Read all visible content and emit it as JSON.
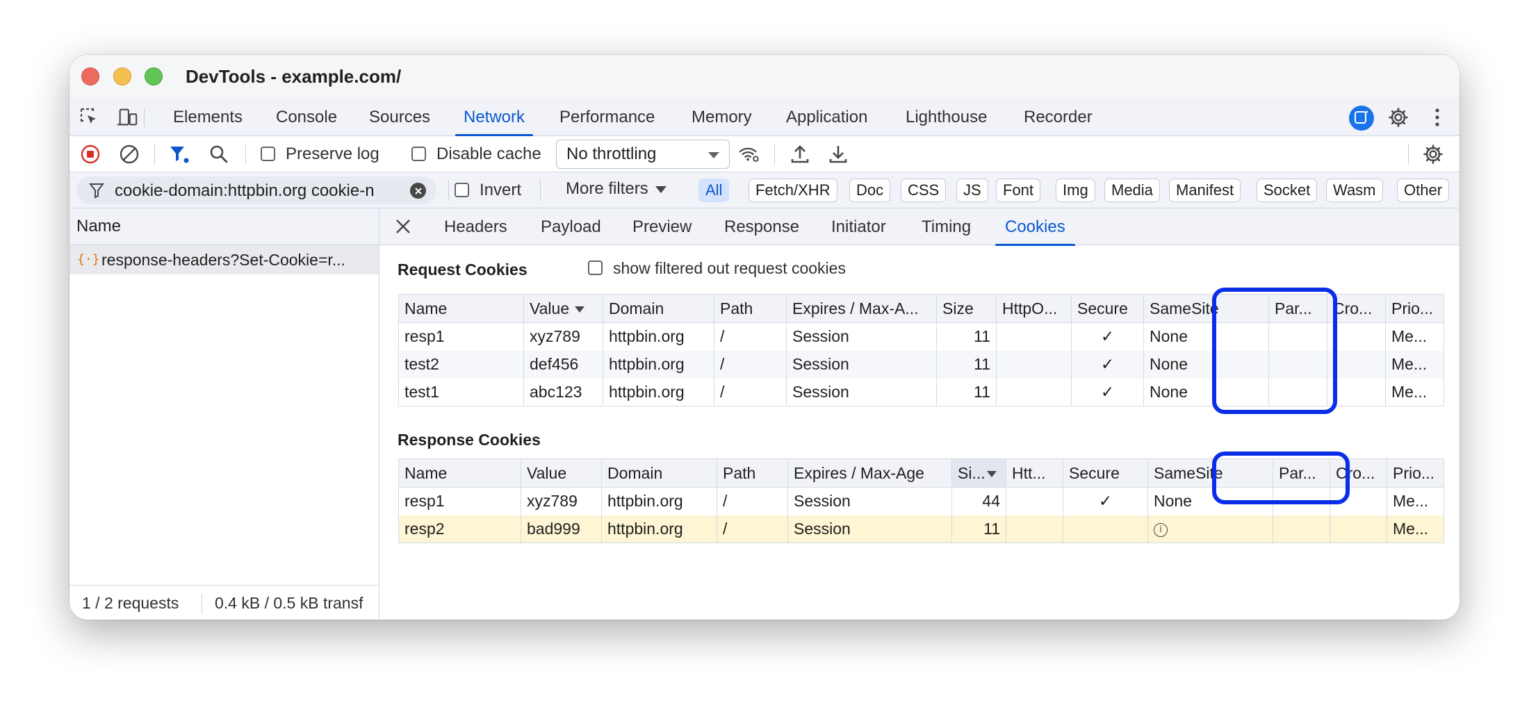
{
  "window": {
    "title": "DevTools - example.com/"
  },
  "main_tabs": [
    {
      "label": "Elements"
    },
    {
      "label": "Console"
    },
    {
      "label": "Sources"
    },
    {
      "label": "Network",
      "active": true
    },
    {
      "label": "Performance"
    },
    {
      "label": "Memory"
    },
    {
      "label": "Application"
    },
    {
      "label": "Lighthouse"
    },
    {
      "label": "Recorder"
    }
  ],
  "toolbar": {
    "preserve_log": "Preserve log",
    "disable_cache": "Disable cache",
    "throttling": "No throttling"
  },
  "filter": {
    "text": "cookie-domain:httpbin.org cookie-n",
    "invert": "Invert",
    "more_filters": "More filters",
    "types": [
      "All",
      "Fetch/XHR",
      "Doc",
      "CSS",
      "JS",
      "Font",
      "Img",
      "Media",
      "Manifest",
      "Socket",
      "Wasm",
      "Other"
    ],
    "active_type": "All"
  },
  "requests": {
    "column_name": "Name",
    "items": [
      {
        "name": "response-headers?Set-Cookie=r...",
        "icon": "fetch-icon"
      }
    ],
    "footer_requests": "1 / 2 requests",
    "footer_transfer": "0.4 kB / 0.5 kB transf"
  },
  "detail_tabs": [
    {
      "label": "Headers"
    },
    {
      "label": "Payload"
    },
    {
      "label": "Preview"
    },
    {
      "label": "Response"
    },
    {
      "label": "Initiator"
    },
    {
      "label": "Timing"
    },
    {
      "label": "Cookies",
      "active": true
    }
  ],
  "request_cookies": {
    "title": "Request Cookies",
    "show_filtered": "show filtered out request cookies",
    "columns": [
      "Name",
      "Value",
      "Domain",
      "Path",
      "Expires / Max-A...",
      "Size",
      "HttpO...",
      "Secure",
      "SameSite",
      "Par...",
      "Cro...",
      "Prio..."
    ],
    "rows": [
      {
        "name": "resp1",
        "value": "xyz789",
        "domain": "httpbin.org",
        "path": "/",
        "expires": "Session",
        "size": "11",
        "httponly": "",
        "secure": "✓",
        "samesite": "None",
        "partition": "",
        "cross": "",
        "priority": "Me..."
      },
      {
        "name": "test2",
        "value": "def456",
        "domain": "httpbin.org",
        "path": "/",
        "expires": "Session",
        "size": "11",
        "httponly": "",
        "secure": "✓",
        "samesite": "None",
        "partition": "",
        "cross": "",
        "priority": "Me..."
      },
      {
        "name": "test1",
        "value": "abc123",
        "domain": "httpbin.org",
        "path": "/",
        "expires": "Session",
        "size": "11",
        "httponly": "",
        "secure": "✓",
        "samesite": "None",
        "partition": "",
        "cross": "",
        "priority": "Me..."
      }
    ]
  },
  "response_cookies": {
    "title": "Response Cookies",
    "columns": [
      "Name",
      "Value",
      "Domain",
      "Path",
      "Expires / Max-Age",
      "Si...",
      "Htt...",
      "Secure",
      "SameSite",
      "Par...",
      "Cro...",
      "Prio..."
    ],
    "rows": [
      {
        "name": "resp1",
        "value": "xyz789",
        "domain": "httpbin.org",
        "path": "/",
        "expires": "Session",
        "size": "44",
        "httponly": "",
        "secure": "✓",
        "samesite": "None",
        "partition": "",
        "cross": "",
        "priority": "Me..."
      },
      {
        "name": "resp2",
        "value": "bad999",
        "domain": "httpbin.org",
        "path": "/",
        "expires": "Session",
        "size": "11",
        "httponly": "",
        "secure": "",
        "samesite": "",
        "partition": "",
        "cross": "",
        "priority": "Me...",
        "blocked": true
      }
    ]
  },
  "colors": {
    "accent": "#0b57d0",
    "highlight": "#0a2de8",
    "blocked_row": "#fdf5d3"
  }
}
